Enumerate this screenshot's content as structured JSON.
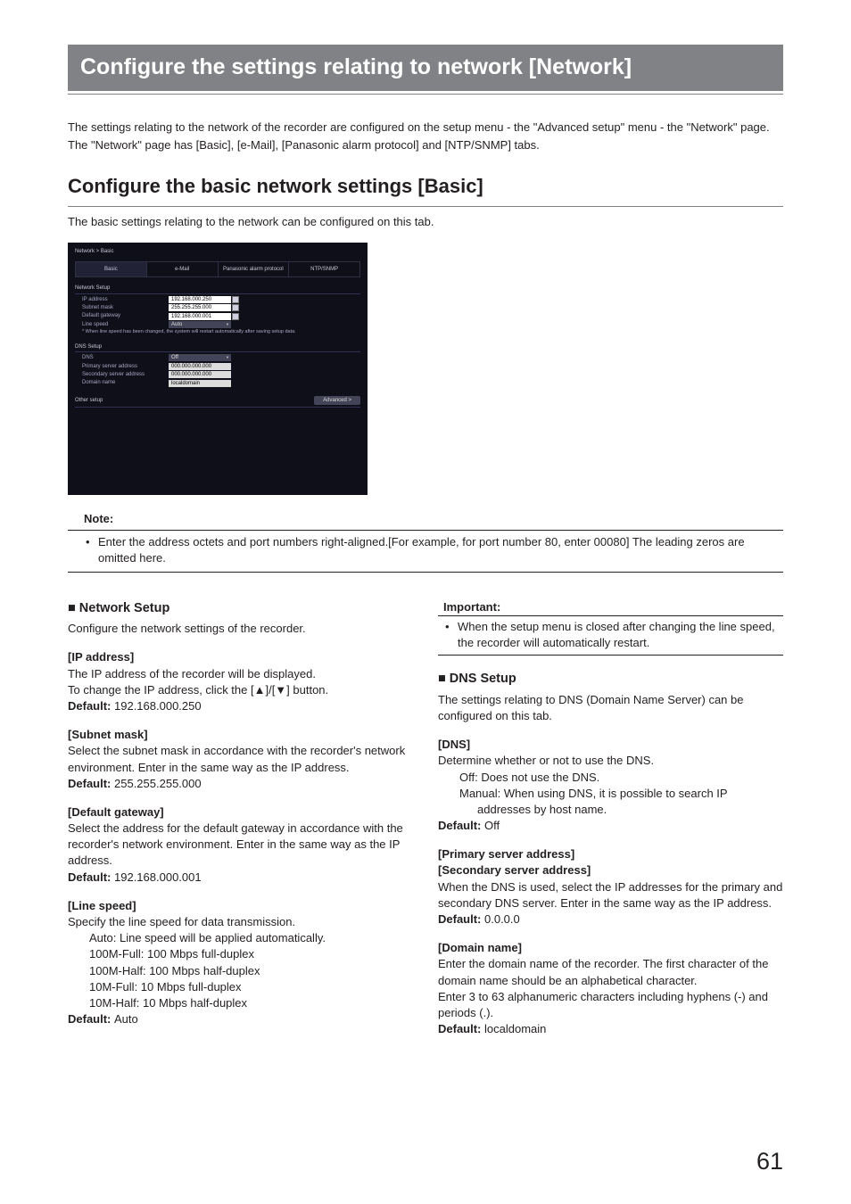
{
  "banner_title": "Configure the settings relating to network [Network]",
  "intro_p1": "The settings relating to the network of the recorder are configured on the setup menu - the \"Advanced setup\" menu - the \"Network\" page.",
  "intro_p2": "The \"Network\" page has [Basic], [e-Mail], [Panasonic alarm protocol] and [NTP/SNMP] tabs.",
  "section_heading": "Configure the basic network settings [Basic]",
  "section_desc": "The basic settings relating to the network can be configured on this tab.",
  "shot": {
    "breadcrumb": "Network  >  Basic",
    "tabs": [
      "Basic",
      "e-Mail",
      "Panasonic alarm protocol",
      "NTP/SNMP"
    ],
    "group1_title": "Network Setup",
    "g1_rows": [
      {
        "label": "IP address",
        "value": "192.168.000.250",
        "spinner": true
      },
      {
        "label": "Subnet mask",
        "value": "255.255.255.000",
        "spinner": true
      },
      {
        "label": "Default gateway",
        "value": "192.168.000.001",
        "spinner": true
      }
    ],
    "g1_line_speed_label": "Line speed",
    "g1_line_speed_value": "Auto",
    "g1_note": "* When line speed has been changed, the system will restart automatically after saving setup data.",
    "group2_title": "DNS Setup",
    "g2_dns_label": "DNS",
    "g2_dns_value": "Off",
    "g2_rows": [
      {
        "label": "Primary server address",
        "value": "000.000.000.000"
      },
      {
        "label": "Secondary server address",
        "value": "000.000.000.000"
      },
      {
        "label": "Domain name",
        "value": "localdomain"
      }
    ],
    "other_label": "Other setup",
    "advanced_btn": "Advanced    >"
  },
  "note_heading": "Note:",
  "note_bullet": "Enter the address octets and port numbers right-aligned.[For example, for port number 80, enter 00080] The leading zeros are omitted here.",
  "left": {
    "setup_head": "Network Setup",
    "setup_desc": "Configure the network settings of the recorder.",
    "ip_title": "[IP address]",
    "ip_l1": "The IP address of the recorder will be displayed.",
    "ip_l2": "To change the IP address, click the [▲]/[▼] button.",
    "ip_default": "192.168.000.250",
    "sm_title": "[Subnet mask]",
    "sm_body": "Select the subnet mask in accordance with the recorder's network environment. Enter in the same way as the IP address.",
    "sm_default": "255.255.255.000",
    "gw_title": "[Default gateway]",
    "gw_body": "Select the address for the default gateway in accordance with the recorder's network environment. Enter in the same way as the IP address.",
    "gw_default": "192.168.000.001",
    "ls_title": "[Line speed]",
    "ls_body": "Specify the line speed for data transmission.",
    "ls_opts": [
      "Auto: Line speed will be applied automatically.",
      "100M-Full: 100 Mbps full-duplex",
      "100M-Half: 100 Mbps half-duplex",
      "10M-Full: 10 Mbps full-duplex",
      "10M-Half: 10 Mbps half-duplex"
    ],
    "ls_default": "Auto"
  },
  "right": {
    "imp_heading": "Important:",
    "imp_bullet": "When the setup menu is closed after changing the line speed, the recorder will automatically restart.",
    "setup_head": "DNS Setup",
    "setup_desc": "The settings relating to DNS (Domain Name Server) can be configured on this tab.",
    "dns_title": "[DNS]",
    "dns_body": "Determine whether or not to use the DNS.",
    "dns_off": "Off: Does not use the DNS.",
    "dns_manual_l1": "Manual: When using DNS, it is possible to search IP",
    "dns_manual_l2": "addresses by host name.",
    "dns_default": "Off",
    "psa_title": "[Primary server address]",
    "ssa_title": "[Secondary server address]",
    "psa_body": "When the DNS is used, select the IP addresses for the primary and secondary DNS server. Enter in the same way as the IP address.",
    "psa_default": "0.0.0.0",
    "dn_title": "[Domain name]",
    "dn_body": "Enter the domain name of the recorder. The first character of the domain name should be an alphabetical character.",
    "dn_body2": "Enter 3 to 63 alphanumeric characters including hyphens (-) and periods (.).",
    "dn_default": "localdomain"
  },
  "default_label": "Default: ",
  "page_number": "61"
}
